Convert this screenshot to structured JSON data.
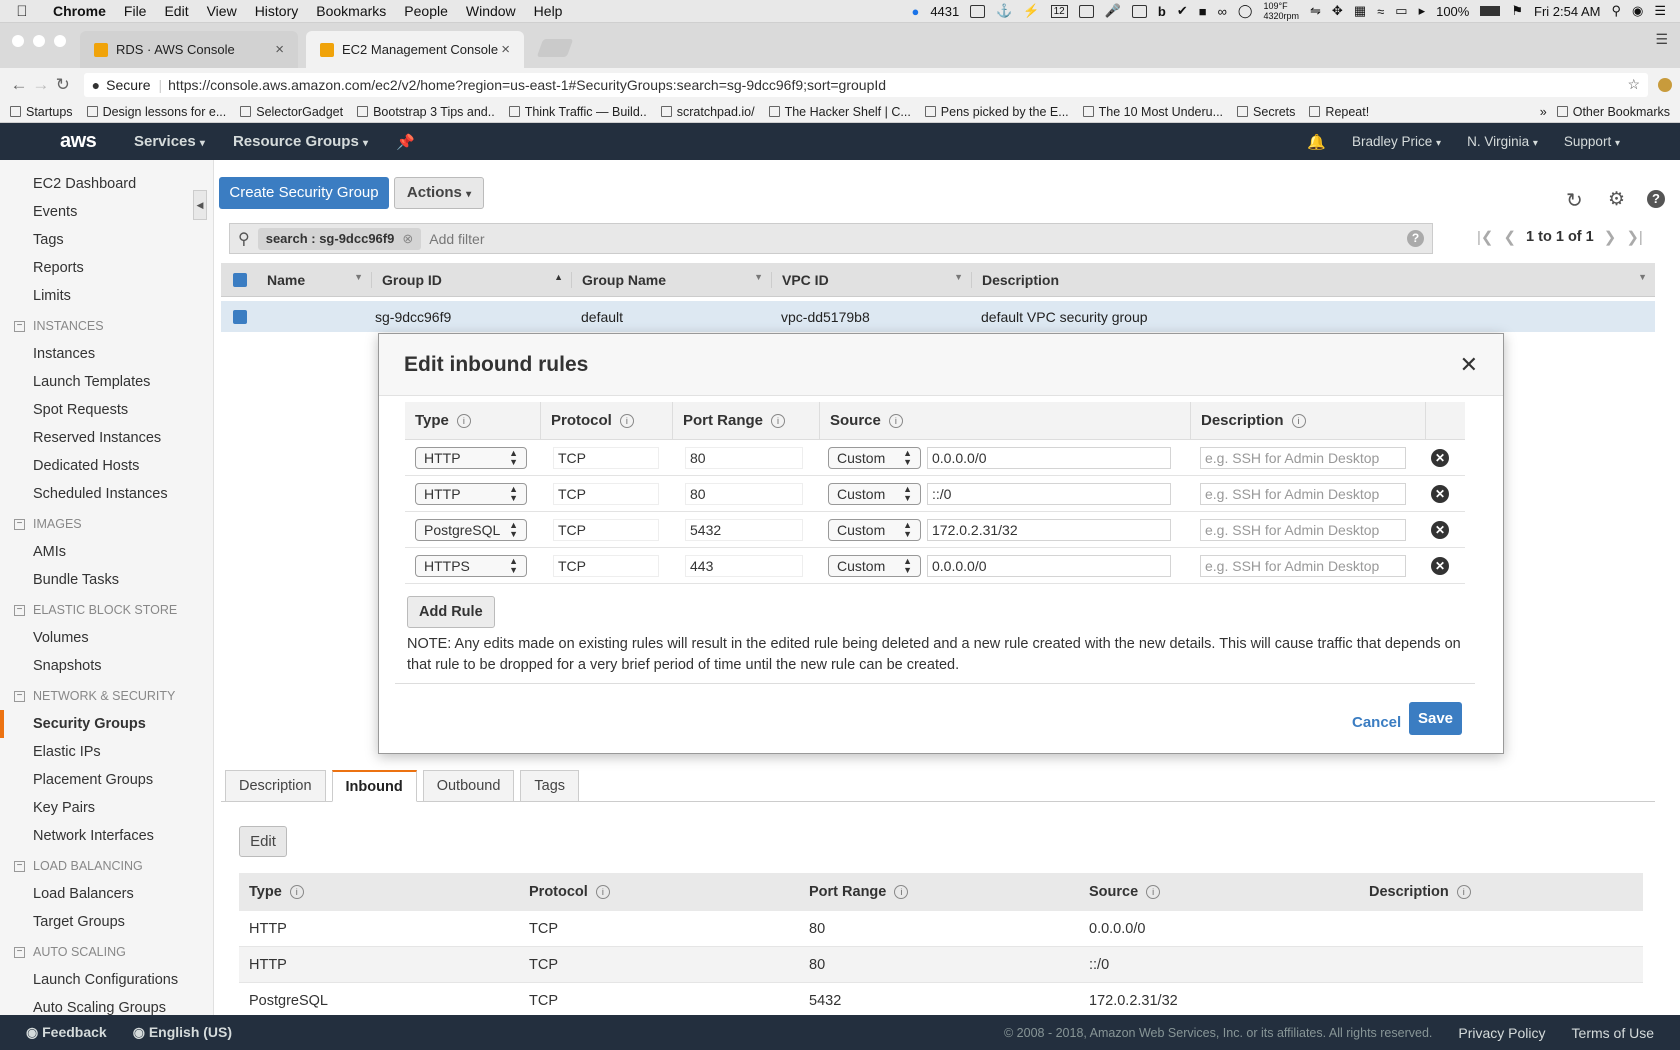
{
  "os_menubar": {
    "app": "Chrome",
    "items": [
      "File",
      "Edit",
      "View",
      "History",
      "Bookmarks",
      "People",
      "Window",
      "Help"
    ],
    "status": {
      "count": "4431",
      "temp": "109°F",
      "rpm": "4320rpm",
      "calendar_day": "12",
      "battery": "100%",
      "time": "Fri 2:54 AM"
    }
  },
  "browser": {
    "tabs": [
      {
        "title": "RDS · AWS Console"
      },
      {
        "title": "EC2 Management Console"
      }
    ],
    "secure_label": "Secure",
    "url": "https://console.aws.amazon.com/ec2/v2/home?region=us-east-1#SecurityGroups:search=sg-9dcc96f9;sort=groupId",
    "bookmarks": [
      "Startups",
      "Design lessons for e...",
      "SelectorGadget",
      "Bootstrap 3 Tips and..",
      "Think Traffic — Build..",
      "scratchpad.io/",
      "The Hacker Shelf | C...",
      "Pens picked by the E...",
      "The 10 Most Underu...",
      "Secrets",
      "Repeat!"
    ],
    "more_bookmarks": "»",
    "other_bookmarks": "Other Bookmarks"
  },
  "aws_nav": {
    "logo": "aws",
    "services": "Services",
    "resource_groups": "Resource Groups",
    "user": "Bradley Price",
    "region": "N. Virginia",
    "support": "Support"
  },
  "sidebar": {
    "top": [
      "EC2 Dashboard",
      "Events",
      "Tags",
      "Reports",
      "Limits"
    ],
    "sections": [
      {
        "title": "INSTANCES",
        "items": [
          "Instances",
          "Launch Templates",
          "Spot Requests",
          "Reserved Instances",
          "Dedicated Hosts",
          "Scheduled Instances"
        ]
      },
      {
        "title": "IMAGES",
        "items": [
          "AMIs",
          "Bundle Tasks"
        ]
      },
      {
        "title": "ELASTIC BLOCK STORE",
        "items": [
          "Volumes",
          "Snapshots"
        ]
      },
      {
        "title": "NETWORK & SECURITY",
        "items": [
          "Security Groups",
          "Elastic IPs",
          "Placement Groups",
          "Key Pairs",
          "Network Interfaces"
        ]
      },
      {
        "title": "LOAD BALANCING",
        "items": [
          "Load Balancers",
          "Target Groups"
        ]
      },
      {
        "title": "AUTO SCALING",
        "items": [
          "Launch Configurations",
          "Auto Scaling Groups"
        ]
      }
    ],
    "active": "Security Groups"
  },
  "main": {
    "create_button": "Create Security Group",
    "actions_button": "Actions",
    "filter_chip": "search : sg-9dcc96f9",
    "add_filter": "Add filter",
    "pagination": "1 to 1 of 1",
    "grid_headers": [
      "Name",
      "Group ID",
      "Group Name",
      "VPC ID",
      "Description"
    ],
    "grid_row": {
      "name": "",
      "group_id": "sg-9dcc96f9",
      "group_name": "default",
      "vpc_id": "vpc-dd5179b8",
      "description": "default VPC security group"
    },
    "detail_tabs": [
      "Description",
      "Inbound",
      "Outbound",
      "Tags"
    ],
    "active_detail_tab": "Inbound",
    "edit_button": "Edit",
    "inbound_headers": [
      "Type",
      "Protocol",
      "Port Range",
      "Source",
      "Description"
    ],
    "inbound_rows": [
      {
        "type": "HTTP",
        "protocol": "TCP",
        "port": "80",
        "source": "0.0.0.0/0",
        "description": ""
      },
      {
        "type": "HTTP",
        "protocol": "TCP",
        "port": "80",
        "source": "::/0",
        "description": ""
      },
      {
        "type": "PostgreSQL",
        "protocol": "TCP",
        "port": "5432",
        "source": "172.0.2.31/32",
        "description": ""
      }
    ]
  },
  "modal": {
    "title": "Edit inbound rules",
    "headers": [
      "Type",
      "Protocol",
      "Port Range",
      "Source",
      "Description"
    ],
    "rules": [
      {
        "type": "HTTP",
        "protocol": "TCP",
        "port": "80",
        "source_mode": "Custom",
        "source": "0.0.0.0/0",
        "description_placeholder": "e.g. SSH for Admin Desktop"
      },
      {
        "type": "HTTP",
        "protocol": "TCP",
        "port": "80",
        "source_mode": "Custom",
        "source": "::/0",
        "description_placeholder": "e.g. SSH for Admin Desktop"
      },
      {
        "type": "PostgreSQL",
        "protocol": "TCP",
        "port": "5432",
        "source_mode": "Custom",
        "source": "172.0.2.31/32",
        "description_placeholder": "e.g. SSH for Admin Desktop"
      },
      {
        "type": "HTTPS",
        "protocol": "TCP",
        "port": "443",
        "source_mode": "Custom",
        "source": "0.0.0.0/0",
        "description_placeholder": "e.g. SSH for Admin Desktop"
      }
    ],
    "add_rule": "Add Rule",
    "note": "NOTE: Any edits made on existing rules will result in the edited rule being deleted and a new rule created with the new details. This will cause traffic that depends on that rule to be dropped for a very brief period of time until the new rule can be created.",
    "cancel": "Cancel",
    "save": "Save"
  },
  "footer": {
    "feedback": "Feedback",
    "language": "English (US)",
    "copyright": "© 2008 - 2018, Amazon Web Services, Inc. or its affiliates. All rights reserved.",
    "privacy": "Privacy Policy",
    "terms": "Terms of Use"
  },
  "colors": {
    "aws_nav": "#232f3e",
    "primary": "#3b7dc2",
    "accent": "#ec7211"
  }
}
